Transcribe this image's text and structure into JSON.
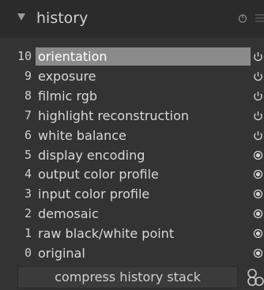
{
  "header": {
    "title": "history",
    "reset_icon": "power-icon",
    "presets_icon": "hamburger-icon"
  },
  "history": {
    "items": [
      {
        "num": "10",
        "label": "orientation",
        "state": "power",
        "selected": true
      },
      {
        "num": "9",
        "label": "exposure",
        "state": "power",
        "selected": false
      },
      {
        "num": "8",
        "label": "filmic rgb",
        "state": "power",
        "selected": false
      },
      {
        "num": "7",
        "label": "highlight reconstruction",
        "state": "power",
        "selected": false
      },
      {
        "num": "6",
        "label": "white balance",
        "state": "power",
        "selected": false
      },
      {
        "num": "5",
        "label": "display encoding",
        "state": "always-on",
        "selected": false
      },
      {
        "num": "4",
        "label": "output color profile",
        "state": "always-on",
        "selected": false
      },
      {
        "num": "3",
        "label": "input color profile",
        "state": "always-on",
        "selected": false
      },
      {
        "num": "2",
        "label": "demosaic",
        "state": "always-on",
        "selected": false
      },
      {
        "num": "1",
        "label": "raw black/white point",
        "state": "always-on",
        "selected": false
      },
      {
        "num": "0",
        "label": "original",
        "state": "always-on",
        "selected": false
      }
    ]
  },
  "footer": {
    "compress_label": "compress history stack",
    "copy_icon": "create-style-icon"
  },
  "colors": {
    "background": "#333333",
    "header_bg": "#2b2b2b",
    "selected_bg": "#8a8a8a",
    "text": "#d0d0d0"
  }
}
